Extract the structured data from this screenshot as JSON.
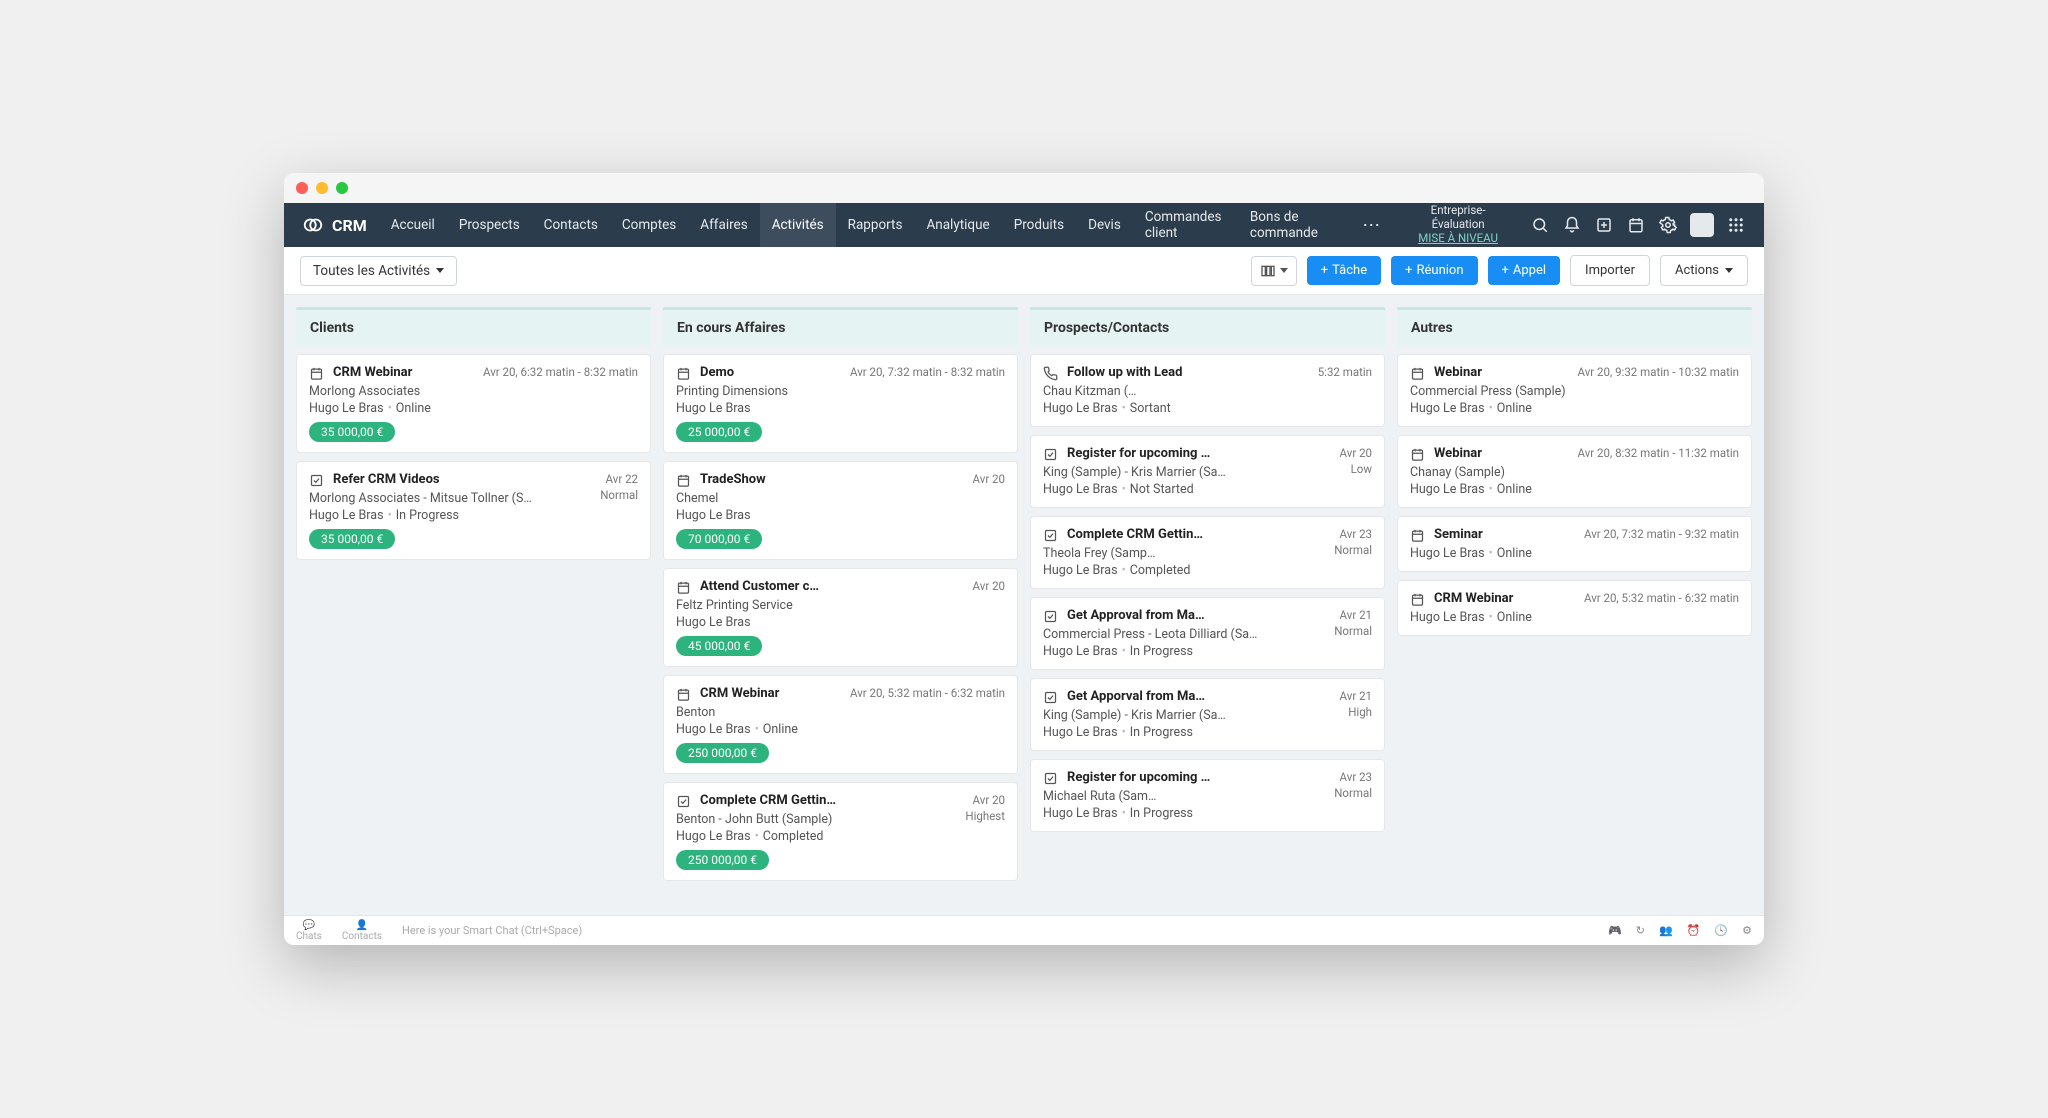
{
  "brand": "CRM",
  "upgrade": {
    "line1": "Entreprise- Évaluation",
    "cta": "MISE À NIVEAU"
  },
  "nav": [
    "Accueil",
    "Prospects",
    "Contacts",
    "Comptes",
    "Affaires",
    "Activités",
    "Rapports",
    "Analytique",
    "Produits",
    "Devis",
    "Commandes client",
    "Bons de commande"
  ],
  "nav_active_index": 5,
  "filter": "Toutes les Activités",
  "buttons": {
    "task": "Tâche",
    "meeting": "Réunion",
    "call": "Appel",
    "import": "Importer",
    "actions": "Actions"
  },
  "columns": [
    {
      "title": "Clients",
      "cards": [
        {
          "icon": "calendar",
          "title": "CRM Webinar",
          "date": "Avr 20, 6:32 matin - 8:32 matin",
          "line": "Morlong Associates",
          "meta": "Hugo Le Bras",
          "meta2": "Online",
          "badge": "35 000,00 €"
        },
        {
          "icon": "check",
          "title": "Refer CRM Videos",
          "date": "Avr 22",
          "extra": "Normal",
          "line": "Morlong Associates - Mitsue Tollner (S…",
          "meta": "Hugo Le Bras",
          "meta2": "In Progress",
          "badge": "35 000,00 €"
        }
      ]
    },
    {
      "title": "En cours Affaires",
      "cards": [
        {
          "icon": "calendar",
          "title": "Demo",
          "date": "Avr 20, 7:32 matin - 8:32 matin",
          "line": "Printing Dimensions",
          "meta": "Hugo Le Bras",
          "badge": "25 000,00 €"
        },
        {
          "icon": "calendar",
          "title": "TradeShow",
          "date": "Avr 20",
          "line": "Chemel",
          "meta": "Hugo Le Bras",
          "badge": "70 000,00 €"
        },
        {
          "icon": "calendar",
          "title": "Attend Customer c…",
          "date": "Avr 20",
          "line": "Feltz Printing Service",
          "meta": "Hugo Le Bras",
          "badge": "45 000,00 €"
        },
        {
          "icon": "calendar",
          "title": "CRM Webinar",
          "date": "Avr 20, 5:32 matin - 6:32 matin",
          "line": "Benton",
          "meta": "Hugo Le Bras",
          "meta2": "Online",
          "badge": "250 000,00 €"
        },
        {
          "icon": "check",
          "title": "Complete CRM Gettin…",
          "date": "Avr 20",
          "extra": "Highest",
          "line": "Benton - John Butt (Sample)",
          "meta": "Hugo Le Bras",
          "meta2": "Completed",
          "badge": "250 000,00 €"
        }
      ]
    },
    {
      "title": "Prospects/Contacts",
      "cards": [
        {
          "icon": "phone",
          "title": "Follow up with Lead",
          "date": "5:32 matin",
          "line": "Chau Kitzman (…",
          "meta": "Hugo Le Bras",
          "meta2": "Sortant"
        },
        {
          "icon": "check",
          "title": "Register for upcoming …",
          "date": "Avr 20",
          "extra": "Low",
          "line": "King (Sample) - Kris Marrier (Sa…",
          "meta": "Hugo Le Bras",
          "meta2": "Not Started"
        },
        {
          "icon": "check",
          "title": "Complete CRM Gettin…",
          "date": "Avr 23",
          "extra": "Normal",
          "line": "Theola Frey (Samp…",
          "meta": "Hugo Le Bras",
          "meta2": "Completed"
        },
        {
          "icon": "check",
          "title": "Get Approval from Ma…",
          "date": "Avr 21",
          "extra": "Normal",
          "line": "Commercial Press - Leota Dilliard (Sa…",
          "meta": "Hugo Le Bras",
          "meta2": "In Progress"
        },
        {
          "icon": "check",
          "title": "Get Apporval from Ma…",
          "date": "Avr 21",
          "extra": "High",
          "line": "King (Sample) - Kris Marrier (Sa…",
          "meta": "Hugo Le Bras",
          "meta2": "In Progress"
        },
        {
          "icon": "check",
          "title": "Register for upcoming …",
          "date": "Avr 23",
          "extra": "Normal",
          "line": "Michael Ruta (Sam…",
          "meta": "Hugo Le Bras",
          "meta2": "In Progress"
        }
      ]
    },
    {
      "title": "Autres",
      "cards": [
        {
          "icon": "calendar",
          "title": "Webinar",
          "date": "Avr 20, 9:32 matin - 10:32 matin",
          "line": "Commercial Press (Sample)",
          "meta": "Hugo Le Bras",
          "meta2": "Online"
        },
        {
          "icon": "calendar",
          "title": "Webinar",
          "date": "Avr 20, 8:32 matin - 11:32 matin",
          "line": "Chanay (Sample)",
          "meta": "Hugo Le Bras",
          "meta2": "Online"
        },
        {
          "icon": "calendar",
          "title": "Seminar",
          "date": "Avr 20, 7:32 matin - 9:32 matin",
          "meta": "Hugo Le Bras",
          "meta2": "Online"
        },
        {
          "icon": "calendar",
          "title": "CRM Webinar",
          "date": "Avr 20, 5:32 matin - 6:32 matin",
          "meta": "Hugo Le Bras",
          "meta2": "Online"
        }
      ]
    }
  ],
  "footer": {
    "chats": "Chats",
    "contacts": "Contacts",
    "smart": "Here is your Smart Chat (Ctrl+Space)"
  }
}
